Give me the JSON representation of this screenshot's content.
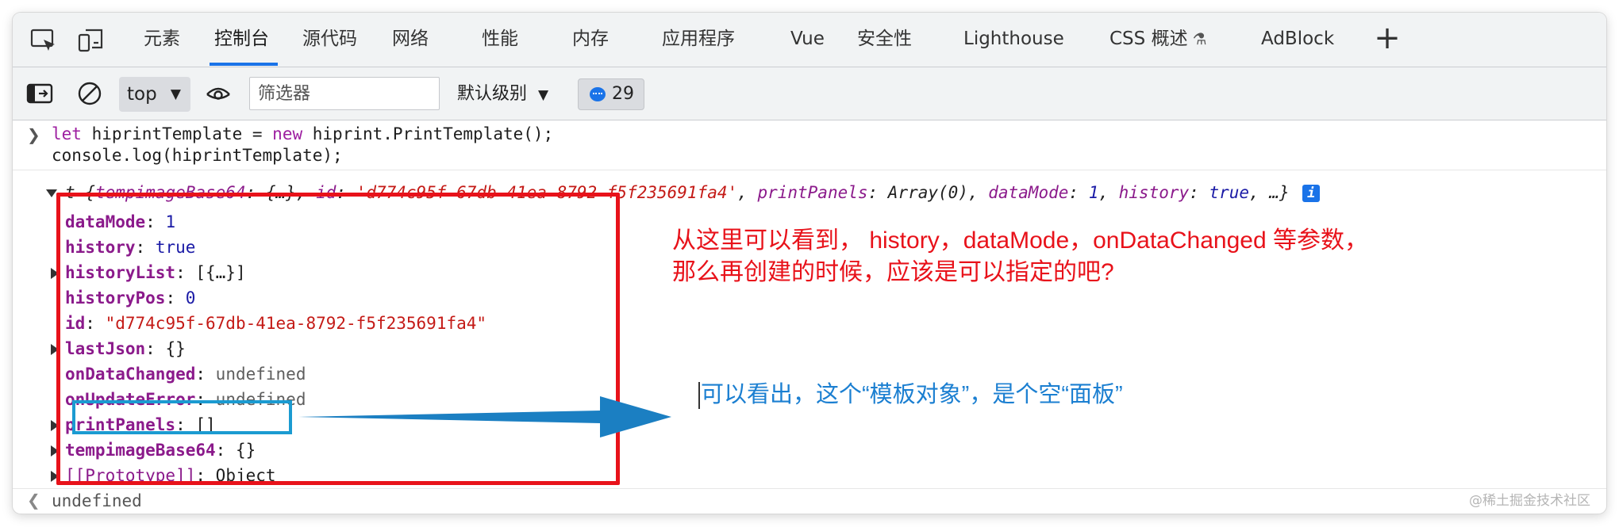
{
  "tabbar": {
    "tabs": [
      {
        "label": "元素"
      },
      {
        "label": "控制台"
      },
      {
        "label": "源代码"
      },
      {
        "label": "网络"
      },
      {
        "label": "性能"
      },
      {
        "label": "内存"
      },
      {
        "label": "应用程序"
      },
      {
        "label": "Vue"
      },
      {
        "label": "安全性"
      },
      {
        "label": "Lighthouse"
      },
      {
        "label": "CSS 概述"
      },
      {
        "label": "AdBlock"
      }
    ],
    "active_tab": "控制台",
    "accent_color": "#1a73e8",
    "icons": [
      "inspect-element-icon",
      "device-toolbar-icon",
      "beaker-icon",
      "plus-icon"
    ]
  },
  "toolbar": {
    "context": "top",
    "filter_placeholder": "筛选器",
    "level": "默认级别",
    "issues_count": "29",
    "icons": [
      "sidebar-toggle-icon",
      "clear-console-icon",
      "caret-down-icon",
      "eye-icon",
      "message-bubble-icon"
    ]
  },
  "console": {
    "input_line1_kw1": "let",
    "input_line1_var": "hiprintTemplate = ",
    "input_line1_kw2": "new",
    "input_line1_rest": "hiprint.PrintTemplate();",
    "input_line2": "console.log(hiprintTemplate);",
    "summary_prefix": "t {",
    "summary_k1": "tempimageBase64",
    "summary_v1": ": {…}, ",
    "summary_k2": "id",
    "summary_v2": "'d774c95f-67db-41ea-8792-f5f235691fa4'",
    "summary_k3": "printPanels",
    "summary_v3": ": Array(0), ",
    "summary_k4": "dataMode",
    "summary_v4": "1",
    "summary_k5": "history",
    "summary_v5": "true",
    "summary_suffix": ", …}",
    "properties": [
      {
        "key": "dataMode",
        "value": "1",
        "type": "number",
        "expandable": false
      },
      {
        "key": "history",
        "value": "true",
        "type": "bool",
        "expandable": false
      },
      {
        "key": "historyList",
        "value": "[{…}]",
        "type": "object",
        "expandable": true
      },
      {
        "key": "historyPos",
        "value": "0",
        "type": "number",
        "expandable": false
      },
      {
        "key": "id",
        "value": "\"d774c95f-67db-41ea-8792-f5f235691fa4\"",
        "type": "string",
        "expandable": false
      },
      {
        "key": "lastJson",
        "value": "{}",
        "type": "object",
        "expandable": true
      },
      {
        "key": "onDataChanged",
        "value": "undefined",
        "type": "undefined",
        "expandable": false
      },
      {
        "key": "onUpdateError",
        "value": "undefined",
        "type": "undefined",
        "expandable": false
      },
      {
        "key": "printPanels",
        "value": "[]",
        "type": "object",
        "expandable": true
      },
      {
        "key": "tempimageBase64",
        "value": "{}",
        "type": "object",
        "expandable": true
      },
      {
        "key": "[[Prototype]]",
        "value": "Object",
        "type": "internal",
        "expandable": true
      }
    ],
    "result": "undefined"
  },
  "annotations": {
    "red_text_line1": "从这里可以看到， history，dataMode，onDataChanged 等参数，",
    "red_text_line2": "那么再创建的时候，应该是可以指定的吧?",
    "blue_text": "可以看出，这个“模板对象”，是个空“面板”",
    "red_color": "#e8121a",
    "blue_color": "#1b9bd1"
  },
  "watermark": "@稀土掘金技术社区"
}
